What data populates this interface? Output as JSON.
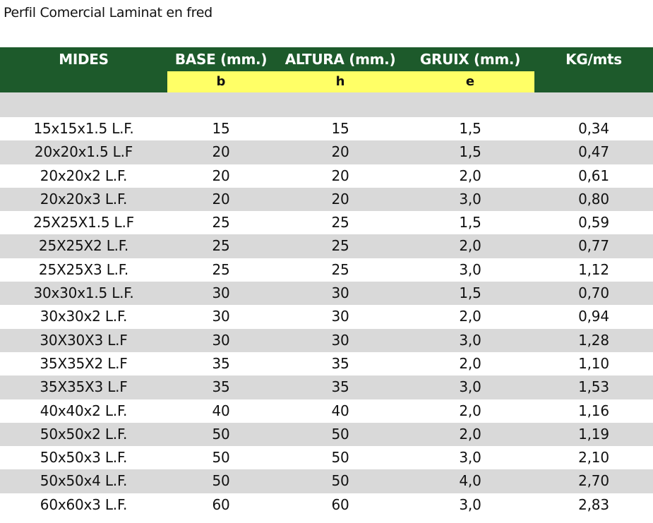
{
  "title": "Perfil Comercial Laminat en fred",
  "columns": [
    {
      "label": "MIDES",
      "sub": ""
    },
    {
      "label": "BASE (mm.)",
      "sub": "b"
    },
    {
      "label": "ALTURA (mm.)",
      "sub": "h"
    },
    {
      "label": "GRUIX (mm.)",
      "sub": "e"
    },
    {
      "label": "KG/mts",
      "sub": ""
    }
  ],
  "colors": {
    "header_green": "#1d5a2b",
    "sub_yellow": "#ffff66",
    "stripe_gray": "#d9d9d9"
  },
  "rows": [
    [
      "15x15x1.5 L.F.",
      "15",
      "15",
      "1,5",
      "0,34"
    ],
    [
      "20x20x1.5 L.F",
      "20",
      "20",
      "1,5",
      "0,47"
    ],
    [
      "20x20x2 L.F.",
      "20",
      "20",
      "2,0",
      "0,61"
    ],
    [
      "20x20x3 L.F.",
      "20",
      "20",
      "3,0",
      "0,80"
    ],
    [
      "25X25X1.5 L.F",
      "25",
      "25",
      "1,5",
      "0,59"
    ],
    [
      "25X25X2 L.F.",
      "25",
      "25",
      "2,0",
      "0,77"
    ],
    [
      "25X25X3 L.F.",
      "25",
      "25",
      "3,0",
      "1,12"
    ],
    [
      "30x30x1.5 L.F.",
      "30",
      "30",
      "1,5",
      "0,70"
    ],
    [
      "30x30x2 L.F.",
      "30",
      "30",
      "2,0",
      "0,94"
    ],
    [
      "30X30X3 L.F",
      "30",
      "30",
      "3,0",
      "1,28"
    ],
    [
      "35X35X2 L.F",
      "35",
      "35",
      "2,0",
      "1,10"
    ],
    [
      "35X35X3 L.F",
      "35",
      "35",
      "3,0",
      "1,53"
    ],
    [
      "40x40x2 L.F.",
      "40",
      "40",
      "2,0",
      "1,16"
    ],
    [
      "50x50x2 L.F.",
      "50",
      "50",
      "2,0",
      "1,19"
    ],
    [
      "50x50x3 L.F.",
      "50",
      "50",
      "3,0",
      "2,10"
    ],
    [
      "50x50x4 L.F.",
      "50",
      "50",
      "4,0",
      "2,70"
    ],
    [
      "60x60x3 L.F.",
      "60",
      "60",
      "3,0",
      "2,83"
    ]
  ]
}
